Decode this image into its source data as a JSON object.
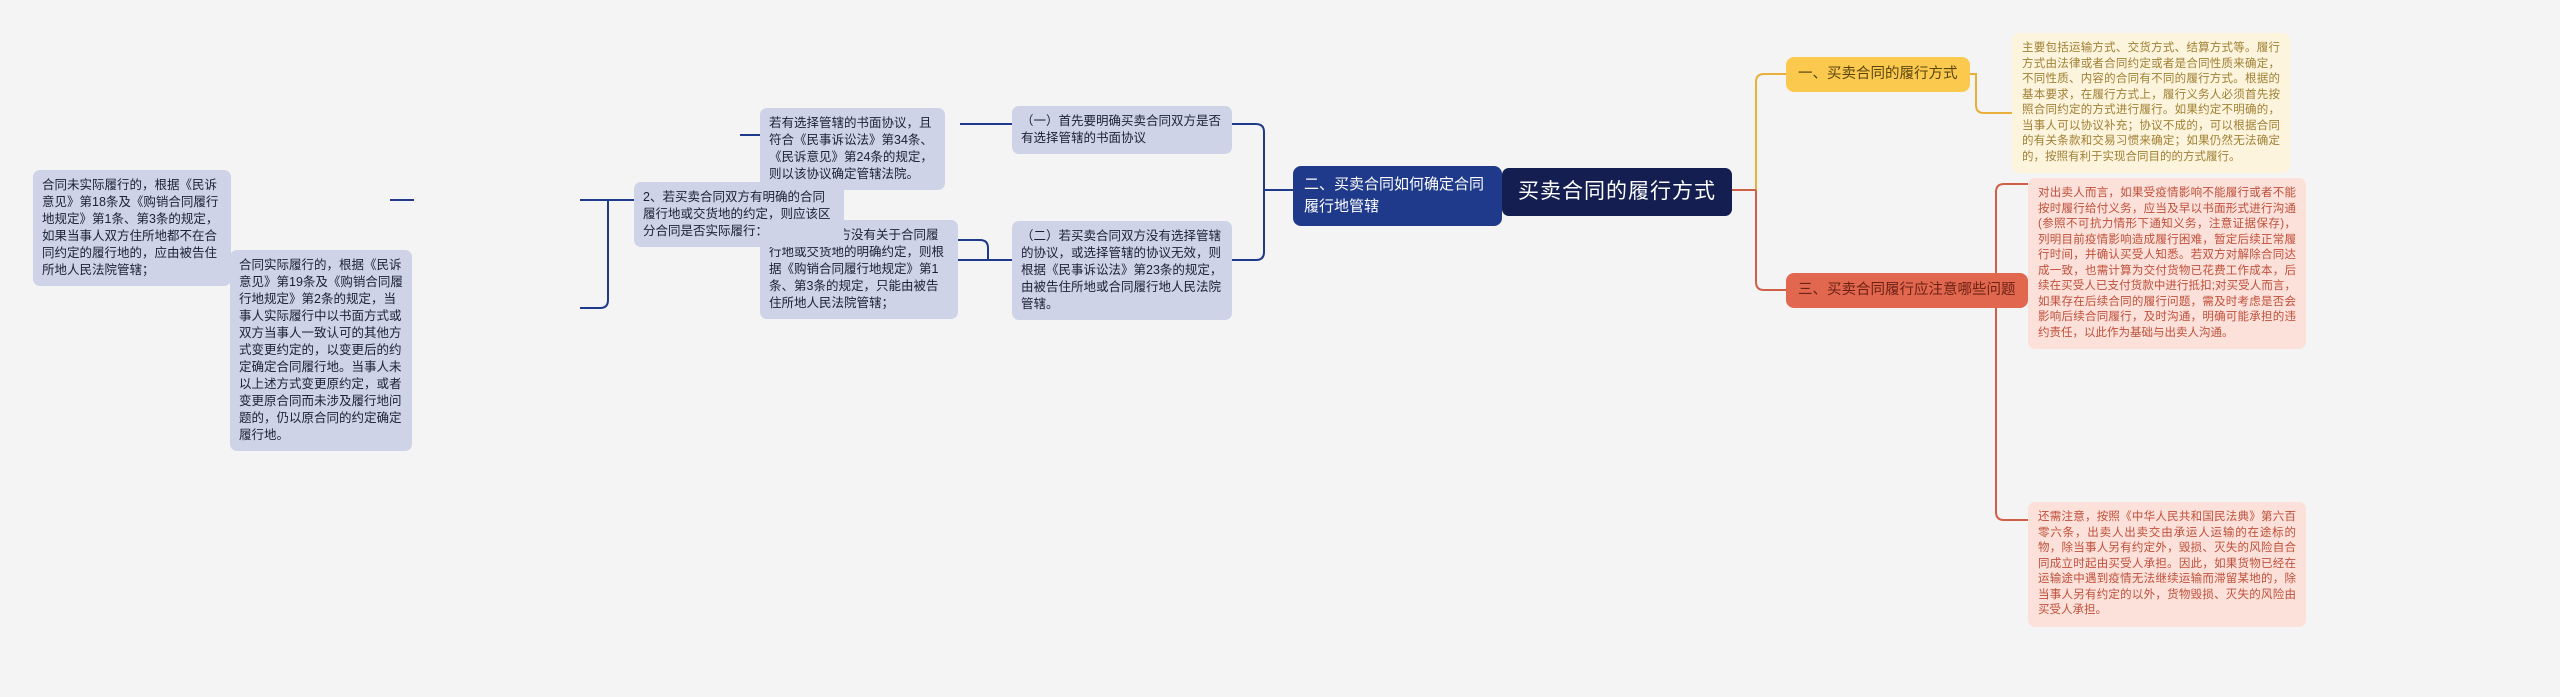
{
  "mindmap": {
    "root": {
      "label": "买卖合同的履行方式"
    },
    "branches": {
      "b1": {
        "label": "一、买卖合同的履行方式",
        "color": "#fbc94e",
        "children": [
          {
            "text": "主要包括运输方式、交货方式、结算方式等。履行方式由法律或者合同约定或者是合同性质来确定，不同性质、内容的合同有不同的履行方式。根据的基本要求，在履行方式上，履行义务人必须首先按照合同约定的方式进行履行。如果约定不明确的，当事人可以协议补充；协议不成的，可以根据合同的有关条款和交易习惯来确定；如果仍然无法确定的，按照有利于实现合同目的的方式履行。"
          }
        ]
      },
      "b2": {
        "label": "二、买卖合同如何确定合同履行地管辖",
        "color": "#1f3a8a",
        "children": [
          {
            "text": "（一）首先要明确买卖合同双方是否有选择管辖的书面协议",
            "children": [
              {
                "text": "若有选择管辖的书面协议，且符合《民事诉讼法》第34条、《民诉意见》第24条的规定，则以该协议确定管辖法院。"
              }
            ]
          },
          {
            "text": "（二）若买卖合同双方没有选择管辖的协议，或选择管辖的协议无效，则根据《民事诉讼法》第23条的规定，由被告住所地或合同履行地人民法院管辖。",
            "children": [
              {
                "text": "1、若合同双方没有关于合同履行地或交货地的明确约定，则根据《购销合同履行地规定》第1条、第3条的规定，只能由被告住所地人民法院管辖；"
              },
              {
                "text": "2、若买卖合同双方有明确的合同履行地或交货地的约定，则应该区分合同是否实际履行：",
                "children": [
                  {
                    "text": "合同未实际履行的，根据《民诉意见》第18条及《购销合同履行地规定》第1条、第3条的规定，如果当事人双方住所地都不在合同约定的履行地的，应由被告住所地人民法院管辖；"
                  },
                  {
                    "text": "合同实际履行的，根据《民诉意见》第19条及《购销合同履行地规定》第2条的规定，当事人实际履行中以书面方式或双方当事人一致认可的其他方式变更约定的，以变更后的约定确定合同履行地。当事人未以上述方式变更原约定，或者变更原合同而未涉及履行地问题的，仍以原合同的约定确定履行地。"
                  }
                ]
              }
            ]
          }
        ]
      },
      "b3": {
        "label": "三、买卖合同履行应注意哪些问题",
        "color": "#e2674f",
        "children": [
          {
            "text": "对出卖人而言，如果受疫情影响不能履行或者不能按时履行给付义务，应当及早以书面形式进行沟通(参照不可抗力情形下通知义务，注意证据保存)，列明目前疫情影响造成履行困难，暂定后续正常履行时间，并确认买受人知悉。若双方对解除合同达成一致，也需计算为交付货物已花费工作成本，后续在买受人已支付货款中进行抵扣;对买受人而言，如果存在后续合同的履行问题，需及时考虑是否会影响后续合同履行，及时沟通，明确可能承担的违约责任，以此作为基础与出卖人沟通。"
          },
          {
            "text": "还需注意，按照《中华人民共和国民法典》第六百零六条，出卖人出卖交由承运人运输的在途标的物，除当事人另有约定外，毁损、灭失的风险自合同成立时起由买受人承担。因此，如果货物已经在运输途中遇到疫情无法继续运输而滞留某地的，除当事人另有约定的以外，货物毁损、灭失的风险由买受人承担。"
          }
        ]
      }
    }
  }
}
